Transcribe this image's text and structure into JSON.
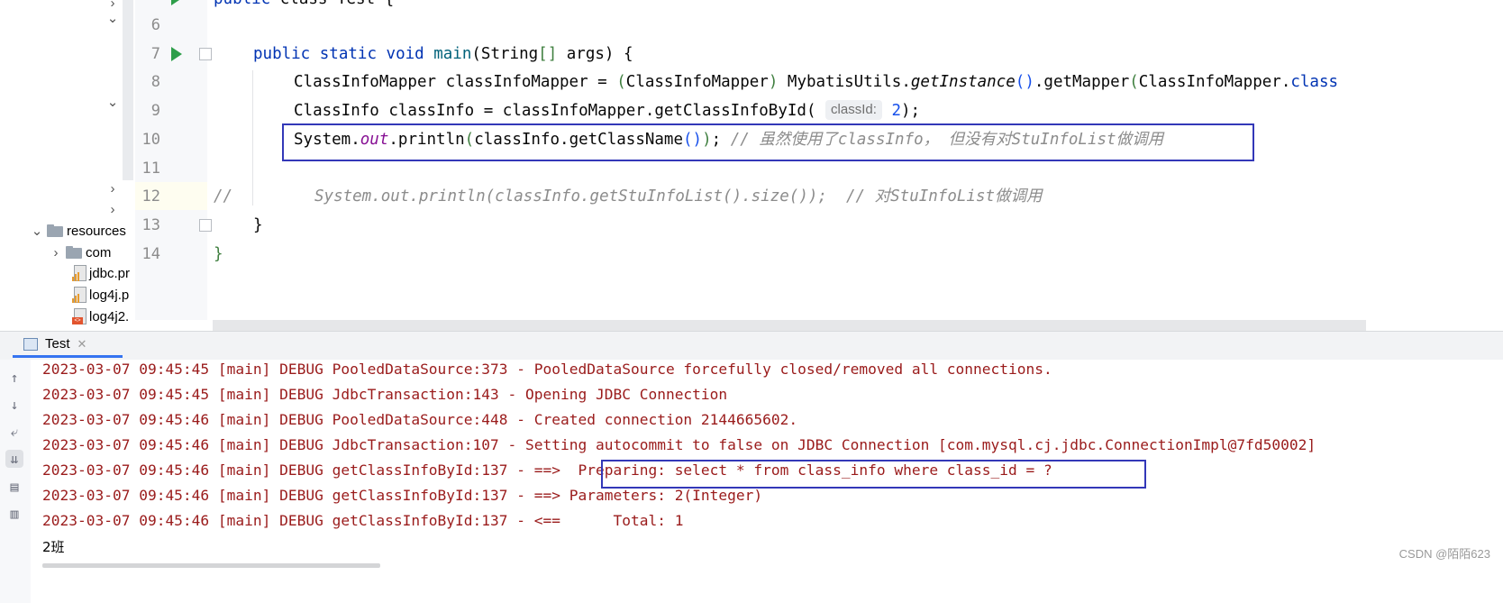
{
  "tree": {
    "items": [
      {
        "label": "resources",
        "type": "folder",
        "expanded": true
      },
      {
        "label": "com",
        "type": "folder",
        "expanded": false
      },
      {
        "label": "jdbc.pr",
        "type": "properties-file"
      },
      {
        "label": "log4j.p",
        "type": "properties-file"
      },
      {
        "label": "log4j2.",
        "type": "xml-file"
      }
    ]
  },
  "editor": {
    "line_numbers": [
      "6",
      "7",
      "8",
      "9",
      "10",
      "11",
      "12",
      "13",
      "14"
    ],
    "line7": {
      "kw1": "public",
      "kw2": "static",
      "kw3": "void",
      "name": "main",
      "rest": "(String",
      "brk": "[]",
      "rest2": " args) {"
    },
    "line8": {
      "a": "ClassInfoMapper classInfoMapper = ",
      "b": "(",
      "c": "ClassInfoMapper",
      "d": ")",
      "e": " MybatisUtils.",
      "f": "getInstance",
      "g": "()",
      "h": ".getMapper",
      "i": "(",
      "j": "ClassInfoMapper.",
      "k": "class"
    },
    "line9": {
      "a": "ClassInfo classInfo = classInfoMapper.getClassInfoById(",
      "hint": "classId:",
      "num": "2",
      "b": ");"
    },
    "line10": {
      "a": "System.",
      "fld": "out",
      "b": ".println",
      "c": "(",
      "d": "classInfo.getClassName",
      "e": "()",
      "f": ")",
      "g": "; ",
      "cmt": "// 虽然使用了classInfo， 但没有对StuInfoList做调用"
    },
    "line12": {
      "cmt1": "//",
      "cmt2": "System.out.println(classInfo.getStuInfoList().size());  // 对StuInfoList做调用"
    },
    "line13": {
      "a": "}"
    },
    "line14": {
      "a": "}"
    },
    "line_top": {
      "a": "public",
      "b": " class Test {"
    }
  },
  "run": {
    "tab_label": "Test",
    "tab_close": "✕",
    "tools": [
      "up-arrow-icon",
      "down-arrow-icon",
      "soft-wrap-icon",
      "scroll-to-end-icon",
      "print-icon",
      "trash-icon"
    ],
    "logs": [
      "2023-03-07 09:45:45 [main] DEBUG PooledDataSource:373 - PooledDataSource forcefully closed/removed all connections.",
      "2023-03-07 09:45:45 [main] DEBUG JdbcTransaction:143 - Opening JDBC Connection",
      "2023-03-07 09:45:46 [main] DEBUG PooledDataSource:448 - Created connection 2144665602.",
      "2023-03-07 09:45:46 [main] DEBUG JdbcTransaction:107 - Setting autocommit to false on JDBC Connection [com.mysql.cj.jdbc.ConnectionImpl@7fd50002]",
      "2023-03-07 09:45:46 [main] DEBUG getClassInfoById:137 - ==>  Preparing: select * from class_info where class_id = ?",
      "2023-03-07 09:45:46 [main] DEBUG getClassInfoById:137 - ==> Parameters: 2(Integer)",
      "2023-03-07 09:45:46 [main] DEBUG getClassInfoById:137 - <==      Total: 1"
    ],
    "output": "2班"
  },
  "watermark": "CSDN @陌陌623",
  "colors": {
    "accent": "#3574f0",
    "highlight_box": "#3338b8",
    "log_text": "#9a1b1b"
  }
}
